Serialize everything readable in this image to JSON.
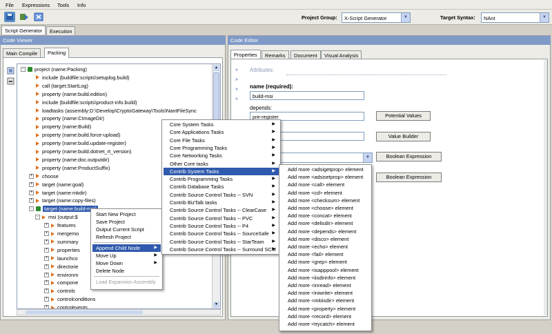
{
  "menu": [
    "File",
    "Expressions",
    "Tools",
    "Info"
  ],
  "toolbar": {
    "project_group_label": "Project Group:",
    "project_group_value": "X-Script Generator",
    "target_syntax_label": "Target Syntax:",
    "target_syntax_value": "NAnt"
  },
  "main_tabs": [
    "Script Generator",
    "Execution"
  ],
  "code_viewer": {
    "title": "Code Viewer",
    "tabs": [
      "Main Compile",
      "Packing"
    ],
    "tree": [
      {
        "level": 0,
        "expander": "-",
        "icon": "check",
        "label": "project (name:Packing)"
      },
      {
        "level": 1,
        "icon": "tri",
        "label": "include (buildfile:scripts\\setuplog.build)"
      },
      {
        "level": 1,
        "icon": "tri",
        "label": "call (target:StartLog)"
      },
      {
        "level": 1,
        "icon": "tri",
        "label": "property (name:build.edition)"
      },
      {
        "level": 1,
        "icon": "tri",
        "label": "include (buildfile:scripts\\product-info.build)"
      },
      {
        "level": 1,
        "icon": "tri",
        "label": "loadtasks (assembly:D:\\Develop\\CryptoGateway\\Tools\\NantFileSync"
      },
      {
        "level": 1,
        "icon": "tri",
        "label": "property (name:CImageDir)"
      },
      {
        "level": 1,
        "icon": "tri",
        "label": "property (name:Build)"
      },
      {
        "level": 1,
        "icon": "tri",
        "label": "property (name:build.force-upload)"
      },
      {
        "level": 1,
        "icon": "tri",
        "label": "property (name:build.update-register)"
      },
      {
        "level": 1,
        "icon": "tri",
        "label": "property (name:build.dotnet_rt_version)"
      },
      {
        "level": 1,
        "icon": "tri",
        "label": "property (name:doc.outputdir)"
      },
      {
        "level": 1,
        "icon": "tri",
        "label": "property (name:ProductSuffix)"
      },
      {
        "level": 1,
        "expander": "+",
        "icon": "tri",
        "label": "choose"
      },
      {
        "level": 1,
        "expander": "+",
        "icon": "tri",
        "label": "target (name:goal)"
      },
      {
        "level": 1,
        "expander": "+",
        "icon": "tri",
        "label": "target (name:mkdir)"
      },
      {
        "level": 1,
        "expander": "+",
        "icon": "tri",
        "label": "target (name:copy-files)"
      },
      {
        "level": 1,
        "expander": "-",
        "icon": "check",
        "label": "target (name:build-msi)",
        "selected": true
      },
      {
        "level": 2,
        "expander": "-",
        "icon": "tri",
        "label": "msi (output:$"
      },
      {
        "level": 3,
        "expander": "+",
        "icon": "tri",
        "label": "features"
      },
      {
        "level": 3,
        "expander": "+",
        "icon": "tri",
        "label": "mergemo"
      },
      {
        "level": 3,
        "expander": "+",
        "icon": "tri",
        "label": "summary"
      },
      {
        "level": 3,
        "expander": "+",
        "icon": "tri",
        "label": "properties"
      },
      {
        "level": 3,
        "expander": "+",
        "icon": "tri",
        "label": "launchco"
      },
      {
        "level": 3,
        "expander": "+",
        "icon": "tri",
        "label": "directorie"
      },
      {
        "level": 3,
        "expander": "+",
        "icon": "tri",
        "label": "environm"
      },
      {
        "level": 3,
        "expander": "+",
        "icon": "tri",
        "label": "compone"
      },
      {
        "level": 3,
        "expander": "+",
        "icon": "tri",
        "label": "controls"
      },
      {
        "level": 3,
        "expander": "+",
        "icon": "tri",
        "label": "controlconditions"
      },
      {
        "level": 3,
        "expander": "+",
        "icon": "tri",
        "label": "controlevents"
      }
    ]
  },
  "context_menu": [
    {
      "label": "Start New Project"
    },
    {
      "label": "Save Project"
    },
    {
      "label": "Output Current Script"
    },
    {
      "label": "Refresh Project"
    },
    {
      "sep": true
    },
    {
      "label": "Append Child Node",
      "submenu": true,
      "highlight": true
    },
    {
      "label": "Move Up",
      "submenu": true
    },
    {
      "label": "Move Down",
      "submenu": true
    },
    {
      "label": "Delete Node"
    },
    {
      "sep": true
    },
    {
      "label": "Load Expansion Assembly",
      "disabled": true
    }
  ],
  "task_menu": [
    {
      "label": "Core System Tasks"
    },
    {
      "label": "Core Applications Tasks"
    },
    {
      "label": "Core File Tasks"
    },
    {
      "label": "Core Programming Tasks"
    },
    {
      "label": "Core Networking Tasks"
    },
    {
      "label": "Other Core tasks"
    },
    {
      "label": "Contrib System Tasks",
      "highlight": true
    },
    {
      "label": "Contrib Programming Tasks"
    },
    {
      "label": "Contrib Database Tasks"
    },
    {
      "label": "Contrib Source Control Tasks -- SVN"
    },
    {
      "label": "Contrib BizTalk tasks"
    },
    {
      "label": "Contrib Source Control Tasks -- ClearCase"
    },
    {
      "label": "Contrib Source Control Tasks -- PVC"
    },
    {
      "label": "Contrib Source Control Tasks -- P4"
    },
    {
      "label": "Contrib Source Control Tasks -- SourceSafe"
    },
    {
      "label": "Contrib Source Control Tasks -- StarTeam"
    },
    {
      "label": "Contrib Source Control Tasks -- Surround SCM"
    }
  ],
  "element_menu": [
    "Add more <adsigetprop> element",
    "Add more <adsisetprop> element",
    "Add more <call> element",
    "Add more <cd> element",
    "Add more <checksum> element",
    "Add more <choose> element",
    "Add more <concat> element",
    "Add more <delisdir> element",
    "Add more <depends> element",
    "Add more <disco> element",
    "Add more <echo> element",
    "Add more <fail> element",
    "Add more <grep> element",
    "Add more <isapppool> element",
    "Add more <iisdirinfo> element",
    "Add more <inread> element",
    "Add more <iniwrite> element",
    "Add more <mkiisdir> element",
    "Add more <property> element",
    "Add more <record> element",
    "Add more <trycatch> element"
  ],
  "code_editor": {
    "title": "Code Editor",
    "tabs": [
      "Properties",
      "Remarks",
      "Document",
      "Visual Analysis"
    ],
    "attributes_label": "Attributes:",
    "name_label": "name (required):",
    "name_value": "build-msi",
    "depends_label": "depends:",
    "depends_value": "pre-register",
    "buttons": [
      "Potential Values",
      "Value Builder",
      "Boolean Expression",
      "Boolean Expression"
    ]
  }
}
